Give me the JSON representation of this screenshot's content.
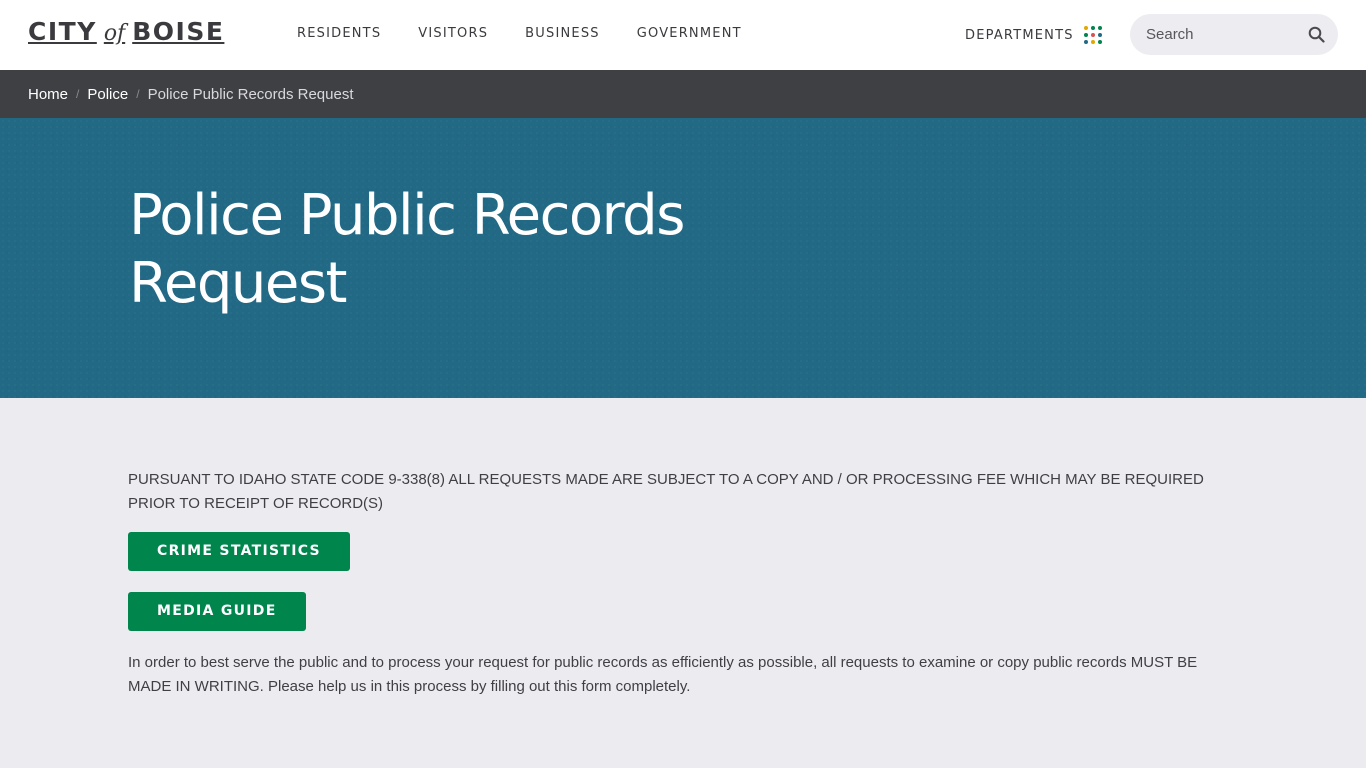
{
  "header": {
    "logo": {
      "part1": "CITY",
      "part2": "of",
      "part3": "BOISE"
    },
    "nav": [
      "RESIDENTS",
      "VISITORS",
      "BUSINESS",
      "GOVERNMENT"
    ],
    "departments_label": "DEPARTMENTS",
    "departments_dot_colors": [
      "#e0a800",
      "#00854d",
      "#00854d",
      "#00854d",
      "#d9534f",
      "#226985",
      "#226985",
      "#e0a800",
      "#00854d"
    ],
    "search_placeholder": "Search"
  },
  "breadcrumb": {
    "items": [
      "Home",
      "Police"
    ],
    "current": "Police Public Records Request"
  },
  "hero": {
    "title": "Police Public Records Request",
    "background_color": "#226985"
  },
  "content": {
    "notice": "PURSUANT TO IDAHO STATE CODE 9-338(8) ALL REQUESTS MADE ARE SUBJECT TO A COPY AND / OR PROCESSING FEE WHICH MAY BE REQUIRED PRIOR TO RECEIPT OF RECORD(S)",
    "buttons": [
      "CRIME STATISTICS",
      "MEDIA GUIDE"
    ],
    "button_color": "#00854d",
    "paragraph": "In order to best serve the public and to process your request for public records as efficiently as possible, all requests to examine or copy public records MUST BE MADE IN WRITING. Please help us in this process by filling out this form completely."
  }
}
